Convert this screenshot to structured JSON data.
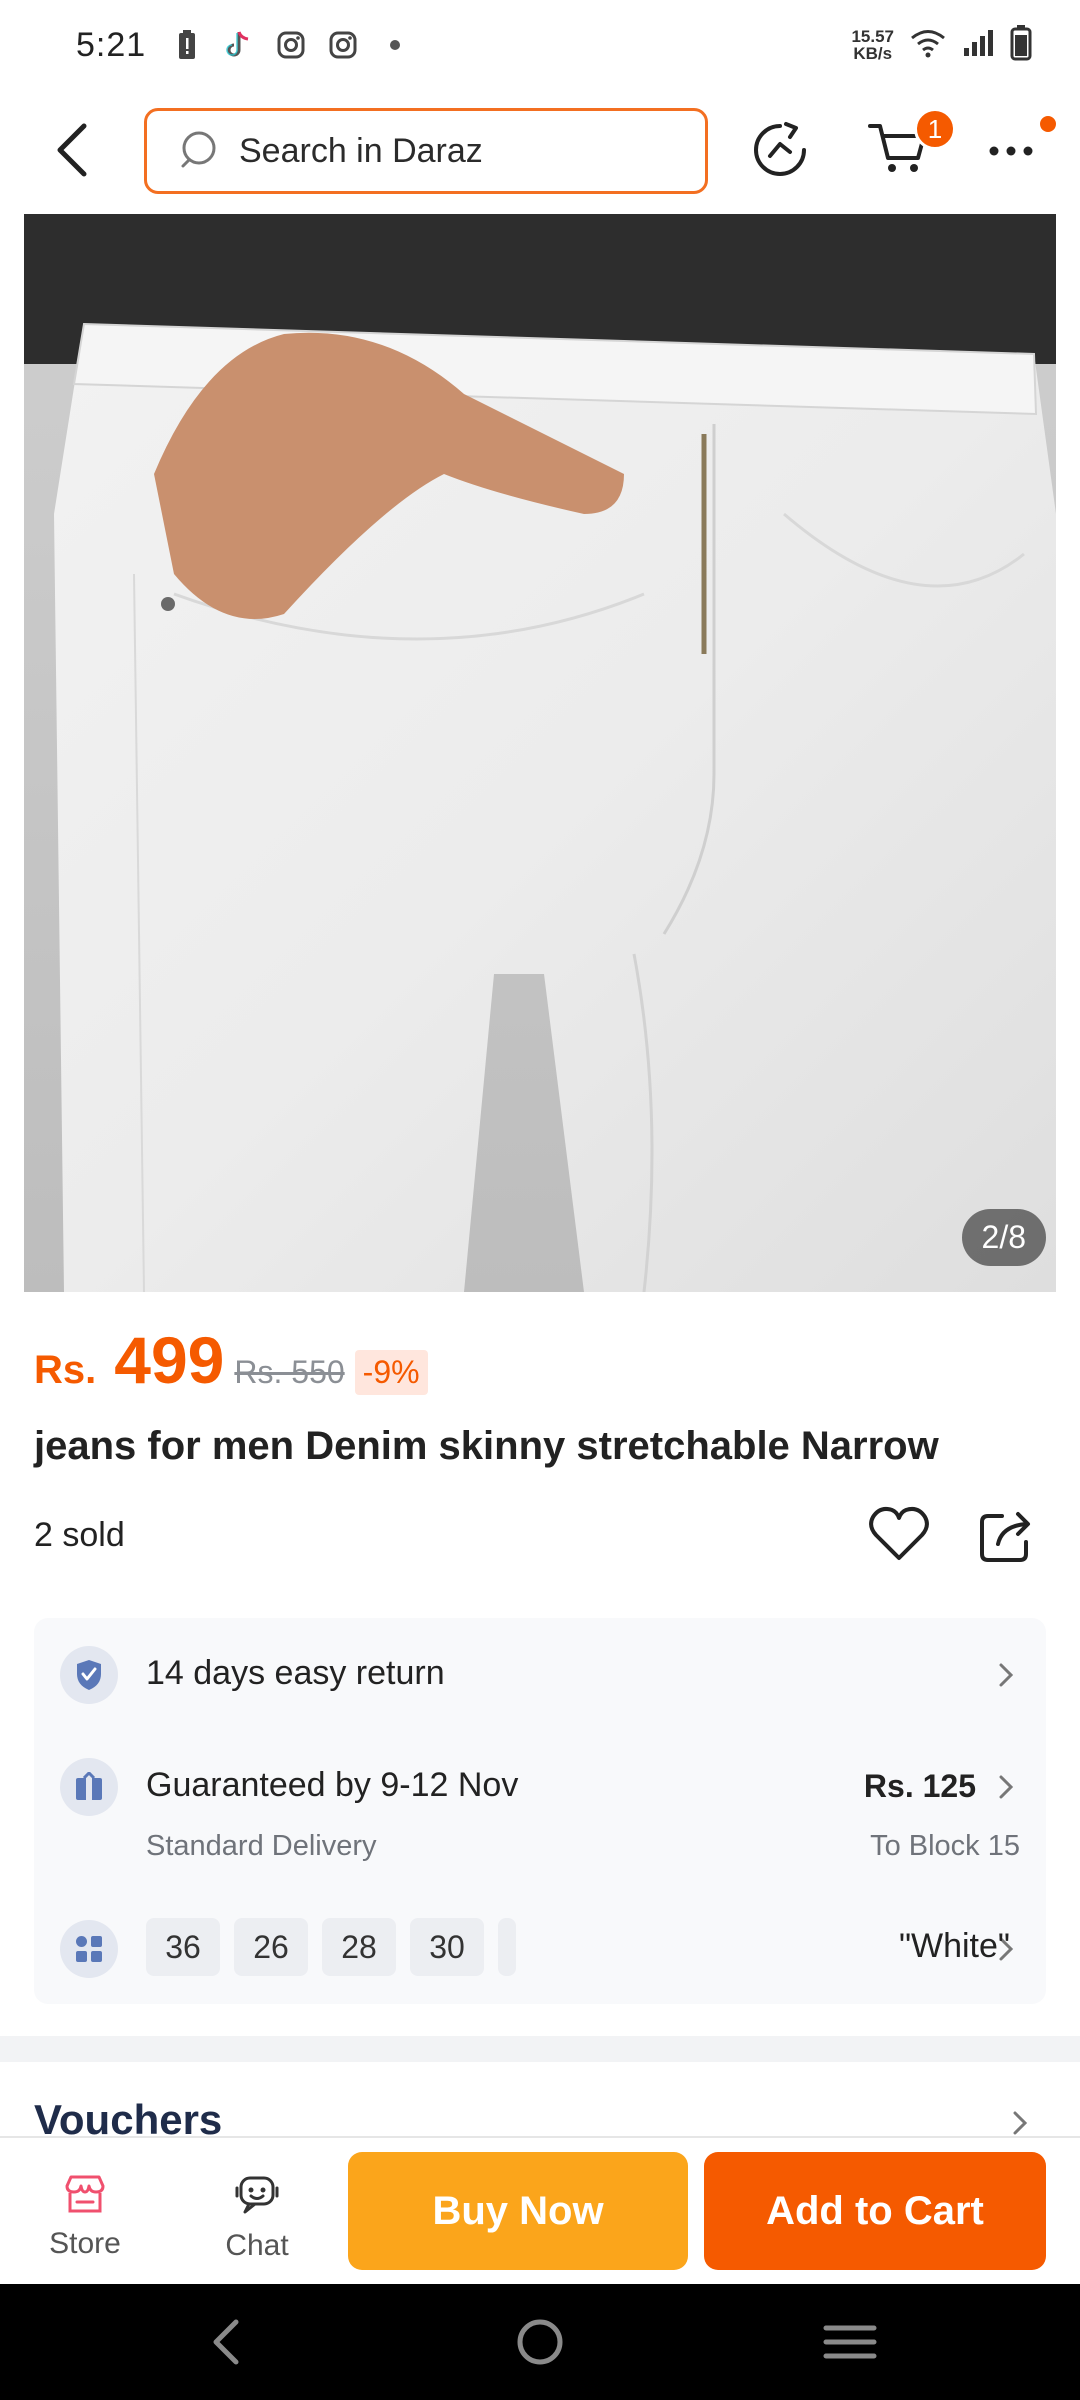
{
  "status_bar": {
    "time": "5:21",
    "net_speed_value": "15.57",
    "net_speed_unit": "KB/s",
    "left_icons": [
      "battery-alert-icon",
      "tiktok-icon",
      "instagram-icon",
      "instagram-icon",
      "dot-icon"
    ],
    "right_icons": [
      "wifi-icon",
      "signal-icon",
      "battery-icon"
    ]
  },
  "top_bar": {
    "search_placeholder": "Search in Daraz",
    "cart_count": "1"
  },
  "product": {
    "image_counter": "2/8",
    "currency": "Rs.",
    "price": "499",
    "original_price": "Rs. 550",
    "discount": "-9%",
    "title": "jeans for men Denim skinny stretchable Narrow",
    "sold": "2 sold"
  },
  "info": {
    "return_text": "14 days easy return",
    "delivery_text": "Guaranteed by 9-12 Nov",
    "delivery_type": "Standard Delivery",
    "delivery_fee": "Rs. 125",
    "delivery_location": "To Block 15",
    "sizes": [
      "36",
      "26",
      "28",
      "30"
    ],
    "color": "\"White\""
  },
  "sections": {
    "vouchers": "Vouchers"
  },
  "bottom_bar": {
    "store_label": "Store",
    "chat_label": "Chat",
    "buy_now_label": "Buy Now",
    "add_to_cart_label": "Add to Cart"
  },
  "colors": {
    "accent": "#f55a00",
    "buy_now": "#fba51b",
    "search_border": "#f36f21"
  }
}
